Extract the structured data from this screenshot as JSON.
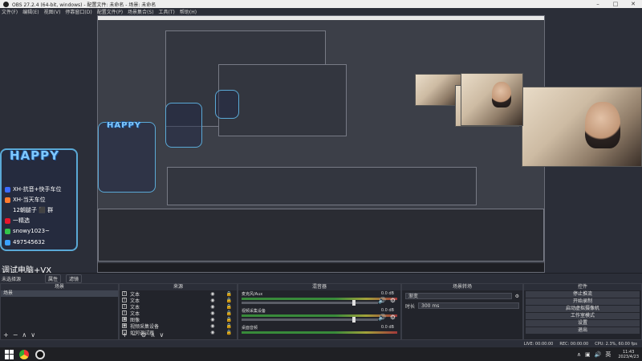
{
  "window": {
    "title": "OBS 27.2.4 (64-bit, windows) - 配置文件: 未命名 - 场景: 未命名",
    "controls": [
      "–",
      "□",
      "✕"
    ]
  },
  "menu": [
    "文件(F)",
    "编辑(E)",
    "视图(V)",
    "停靠窗口(D)",
    "配置文件(P)",
    "场景集合(S)",
    "工具(T)",
    "帮助(H)"
  ],
  "overlay": {
    "brand": "HAPPY",
    "lines": [
      {
        "icon": "tiktok-icon",
        "color": "#3b6cff",
        "text": "XH-抗音+快手车位"
      },
      {
        "icon": "kuaishou-icon",
        "color": "#ff7a2e",
        "text": "XH-当天车位"
      },
      {
        "icon": "wechat-icon",
        "color": "#31c44a",
        "text": "12朝腿子 ⬛ 群"
      },
      {
        "icon": "weibo-icon",
        "color": "#e6162d",
        "text": "一精选"
      },
      {
        "icon": "wechat-icon",
        "color": "#31c44a",
        "text": "snowy1023~"
      },
      {
        "icon": "qq-icon",
        "color": "#3aa0ff",
        "text": "497545632"
      }
    ]
  },
  "preview": {
    "debug_label": "调试电脑+VX"
  },
  "dock_header": {
    "scene_label": "未选择源",
    "properties_button": "属性",
    "filters_button": "滤镜"
  },
  "scenes": {
    "title": "场景",
    "items": [
      "场景"
    ],
    "footer": [
      "+",
      "−",
      "∧",
      "∨"
    ]
  },
  "sources": {
    "title": "来源",
    "items": [
      {
        "icon": "text-icon",
        "label": "文本",
        "glyph": "T"
      },
      {
        "icon": "text-icon",
        "label": "文本",
        "glyph": "T"
      },
      {
        "icon": "text-icon",
        "label": "文本",
        "glyph": "T"
      },
      {
        "icon": "text-icon",
        "label": "文本",
        "glyph": "T"
      },
      {
        "icon": "image-icon",
        "label": "图像",
        "glyph": "▣"
      },
      {
        "icon": "camera-icon",
        "label": "视频采集设备",
        "glyph": "◉"
      },
      {
        "icon": "monitor-icon",
        "label": "如何调试器",
        "glyph": "▭"
      }
    ],
    "footer": [
      "+",
      "−",
      "⚙",
      "∧",
      "∨"
    ]
  },
  "mixer": {
    "title": "混音器",
    "tracks": [
      {
        "name": "麦克风/Aux",
        "db": "0.0 dB"
      },
      {
        "name": "视频采集设备",
        "db": "0.0 dB"
      },
      {
        "name": "桌面音频",
        "db": "0.0 dB"
      }
    ]
  },
  "transitions": {
    "title": "场景转场",
    "type_value": "渐变",
    "duration_label": "时长",
    "duration_value": "300 ms"
  },
  "controls": {
    "title": "控件",
    "buttons": [
      "停止推流",
      "开始录制",
      "启动虚拟摄像机",
      "工作室模式",
      "设置",
      "退出"
    ]
  },
  "status": {
    "live": "LIVE: 00:00:00",
    "rec": "REC: 00:00:00",
    "cpu": "CPU: 2.3%, 60.00 fps"
  },
  "taskbar": {
    "time": "11:43",
    "date": "2023/4/23",
    "lang": "英"
  }
}
